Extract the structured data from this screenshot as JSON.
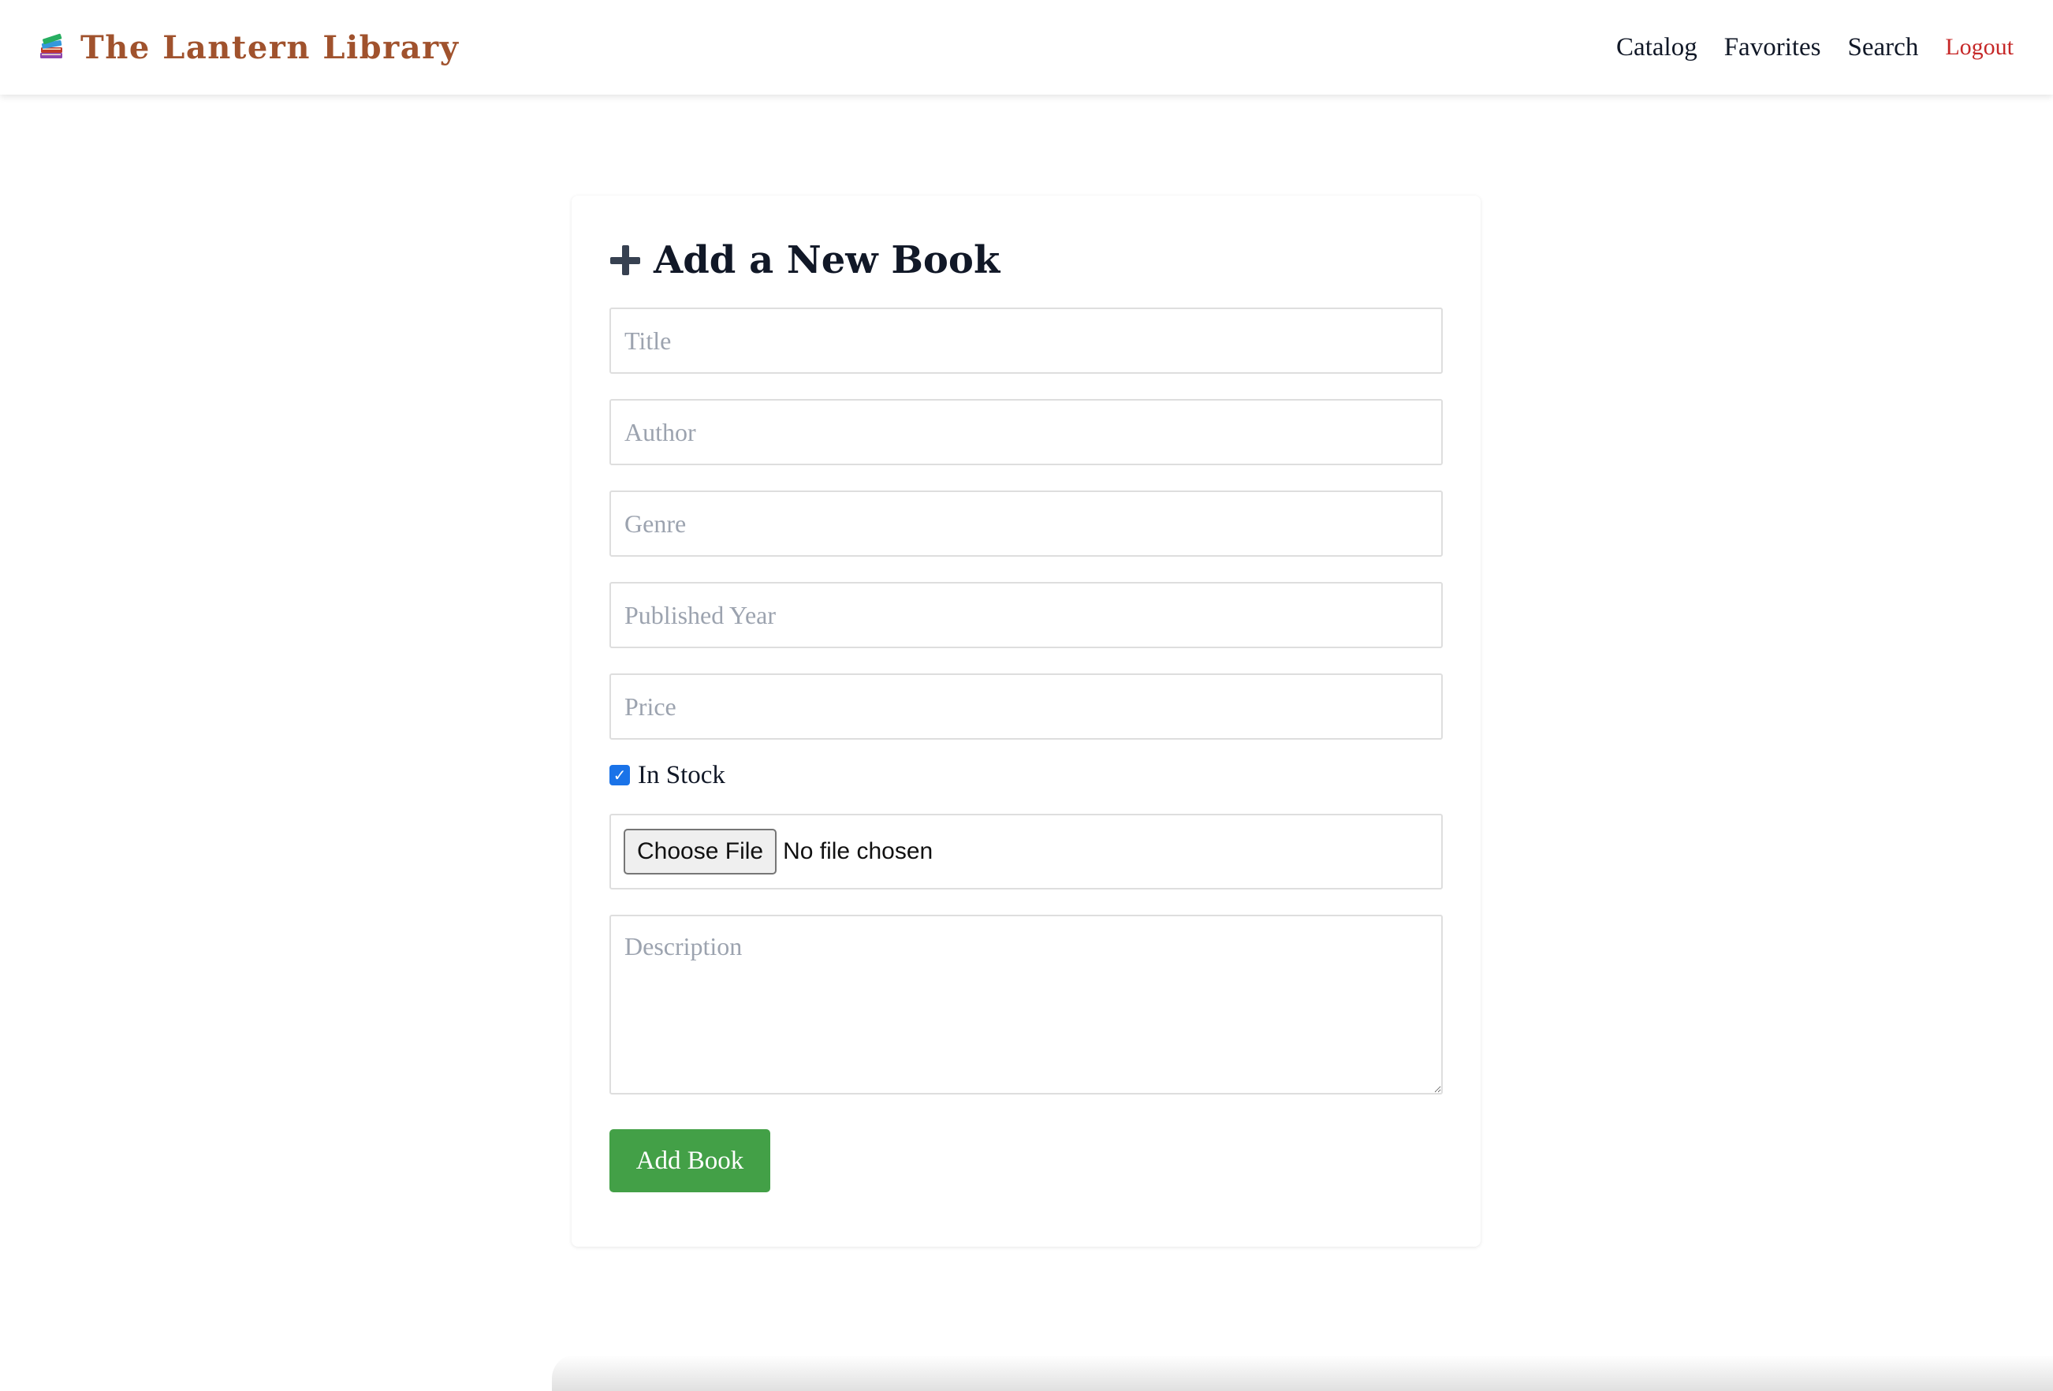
{
  "app": {
    "title": "The Lantern Library",
    "logo_icon": "books-icon",
    "brand_color": "#a0522d"
  },
  "nav": {
    "items": [
      {
        "label": "Catalog"
      },
      {
        "label": "Favorites"
      },
      {
        "label": "Search"
      }
    ],
    "logout_label": "Logout",
    "logout_color": "#c62828"
  },
  "form": {
    "heading_icon": "plus-icon",
    "heading": "Add a New Book",
    "title_placeholder": "Title",
    "author_placeholder": "Author",
    "genre_placeholder": "Genre",
    "year_placeholder": "Published Year",
    "price_placeholder": "Price",
    "in_stock_label": "In Stock",
    "in_stock_checked": true,
    "file_button_label": "Choose File",
    "file_status": "No file chosen",
    "description_placeholder": "Description",
    "submit_label": "Add Book",
    "submit_color": "#43a047"
  }
}
